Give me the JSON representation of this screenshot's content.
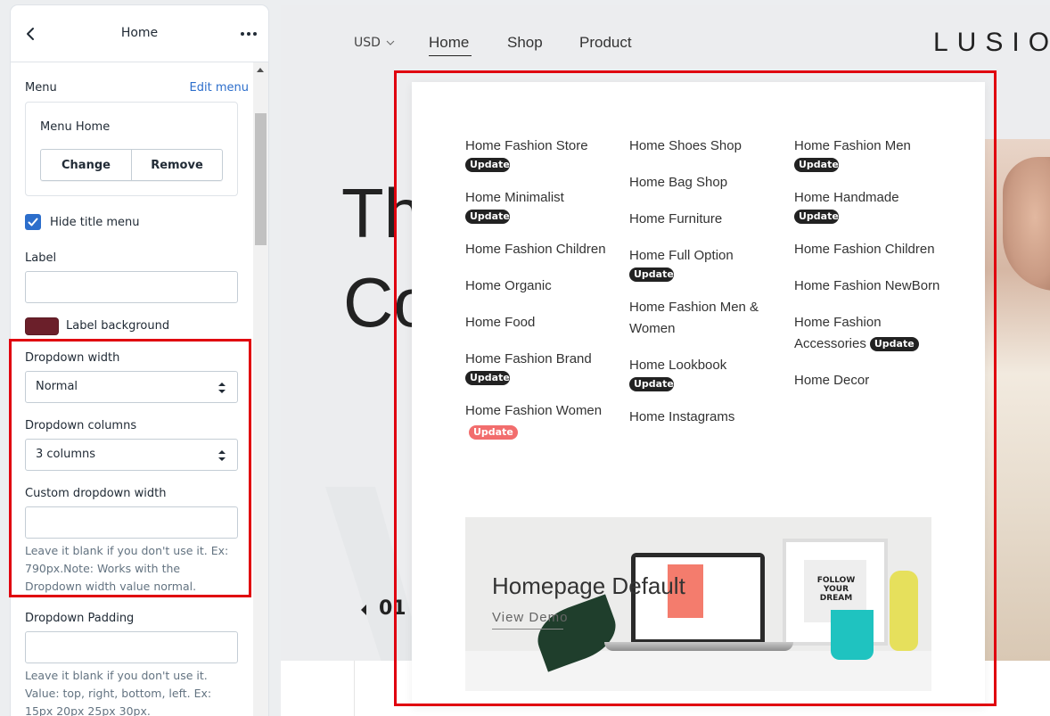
{
  "sidebar": {
    "title": "Home",
    "menu_label": "Menu",
    "edit_menu_link": "Edit menu",
    "menu_card": {
      "name": "Menu Home",
      "change_button": "Change",
      "remove_button": "Remove"
    },
    "hide_title": {
      "label": "Hide title menu",
      "checked": true
    },
    "label_field": {
      "label": "Label",
      "value": "",
      "placeholder": ""
    },
    "label_background": {
      "label": "Label background",
      "color": "#6b1f2a"
    },
    "dropdown_width": {
      "label": "Dropdown width",
      "value": "Normal"
    },
    "dropdown_columns": {
      "label": "Dropdown columns",
      "value": "3 columns"
    },
    "custom_dropdown_width": {
      "label": "Custom dropdown width",
      "value": "",
      "help": "Leave it blank if you don't use it. Ex: 790px.Note: Works with the Dropdown width value normal."
    },
    "dropdown_padding": {
      "label": "Dropdown Padding",
      "value": "",
      "help": "Leave it blank if you don't use it. Value: top, right, bottom, left. Ex: 15px 20px 25px 30px."
    }
  },
  "preview": {
    "nav": {
      "currency": "USD",
      "items": [
        "Home",
        "Shop",
        "Product"
      ],
      "active": "Home"
    },
    "logo": "LUSION",
    "hero": {
      "line1": "Th",
      "line2": "Co",
      "slide_number": "01"
    },
    "dropdown": {
      "columns": [
        [
          {
            "label": "Home Fashion Store",
            "badge": "Update",
            "badge_style": "dark-below"
          },
          {
            "label": "Home Minimalist",
            "badge": "Update",
            "badge_style": "dark-below"
          },
          {
            "label": "Home Fashion Children",
            "badge": ""
          },
          {
            "label": "Home Organic",
            "badge": ""
          },
          {
            "label": "Home Food",
            "badge": ""
          },
          {
            "label": "Home Fashion Brand",
            "badge": "Update",
            "badge_style": "dark-below"
          },
          {
            "label": "Home Fashion Women",
            "badge": "Update",
            "badge_style": "red-inline"
          }
        ],
        [
          {
            "label": "Home Shoes Shop",
            "badge": ""
          },
          {
            "label": "Home Bag Shop",
            "badge": ""
          },
          {
            "label": "Home Furniture",
            "badge": ""
          },
          {
            "label": "Home Full Option",
            "badge": "Update",
            "badge_style": "dark-below"
          },
          {
            "label": "Home Fashion Men & Women",
            "badge": ""
          },
          {
            "label": "Home Lookbook",
            "badge": "Update",
            "badge_style": "dark-below"
          },
          {
            "label": "Home Instagrams",
            "badge": ""
          }
        ],
        [
          {
            "label": "Home Fashion Men",
            "badge": "Update",
            "badge_style": "dark-below"
          },
          {
            "label": "Home Handmade",
            "badge": "Update",
            "badge_style": "dark-below"
          },
          {
            "label": "Home Fashion Children",
            "badge": ""
          },
          {
            "label": "Home Fashion NewBorn",
            "badge": ""
          },
          {
            "label": "Home Fashion Accessories",
            "badge": "Update",
            "badge_style": "dark-inline"
          },
          {
            "label": "Home Decor",
            "badge": ""
          }
        ]
      ],
      "promo": {
        "title": "Homepage Default",
        "link": "View Demo",
        "frame_text": "FOLLOW YOUR DREAM"
      }
    }
  },
  "colors": {
    "highlight": "#e0000f",
    "accent": "#2c6ecb",
    "badge_dark": "#222222",
    "badge_red": "#f26d6d"
  }
}
